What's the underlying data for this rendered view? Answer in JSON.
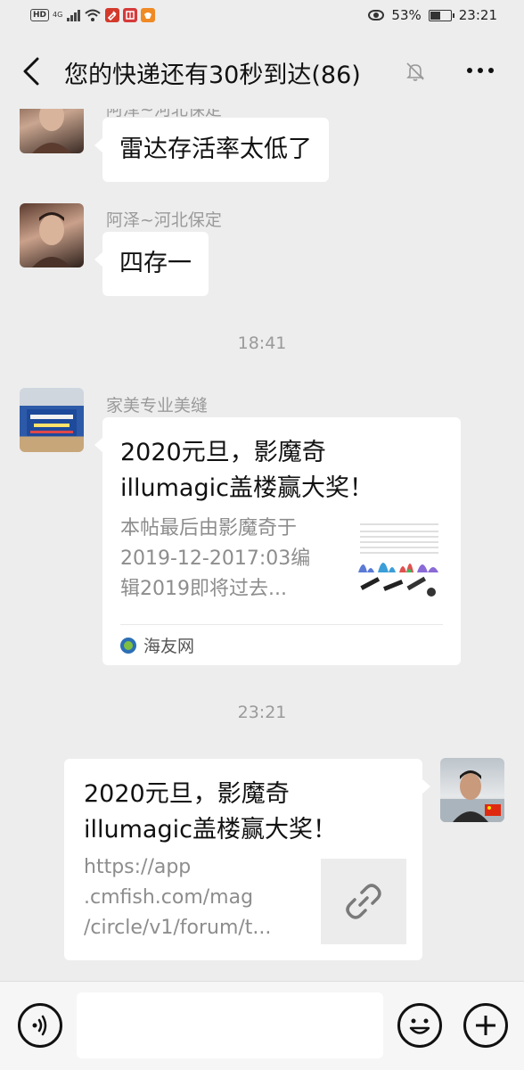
{
  "status_bar": {
    "hd": "HD",
    "network": "4G",
    "battery_percent": "53%",
    "battery_level": 0.53,
    "time": "23:21"
  },
  "header": {
    "title": "您的快递还有30秒到达(86)",
    "icons": [
      "back-icon",
      "mute-bell-icon",
      "more-icon"
    ]
  },
  "messages": [
    {
      "sender": "阿泽~河北保定",
      "text": "雷达存活率太低了"
    },
    {
      "sender": "阿泽~河北保定",
      "text": "四存一"
    },
    {
      "timestamp": "18:41"
    },
    {
      "sender": "家美专业美缝",
      "card": {
        "title": "2020元旦，影魔奇illumagic盖楼赢大奖！",
        "description": "本帖最后由影魔奇于2019-12-2017:03编辑2019即将过去...",
        "source": "海友网"
      }
    },
    {
      "timestamp": "23:21"
    },
    {
      "self": true,
      "card": {
        "title": "2020元旦，影魔奇illumagic盖楼赢大奖！",
        "description": "https://app.cmfish.com/mag/circle/v1/forum/t..."
      }
    }
  ],
  "ui": {
    "title_lines_left": [
      "2020元旦，影魔奇",
      "illumagic盖楼赢大奖！"
    ],
    "desc_lines_left": [
      "本帖最后由影魔奇于",
      "2019-12-2017:03编",
      "辑2019即将过去..."
    ],
    "title_lines_right": [
      "2020元旦，影魔奇",
      "illumagic盖楼赢大奖！"
    ],
    "desc_lines_right": [
      "https://app",
      ".cmfish.com/mag",
      "/circle/v1/forum/t..."
    ]
  },
  "input_bar": {
    "icons": [
      "voice-icon",
      "emoji-icon",
      "plus-icon"
    ]
  },
  "colors": {
    "background": "#ededed",
    "bubble": "#ffffff",
    "meta_text": "#9a9a9a"
  }
}
